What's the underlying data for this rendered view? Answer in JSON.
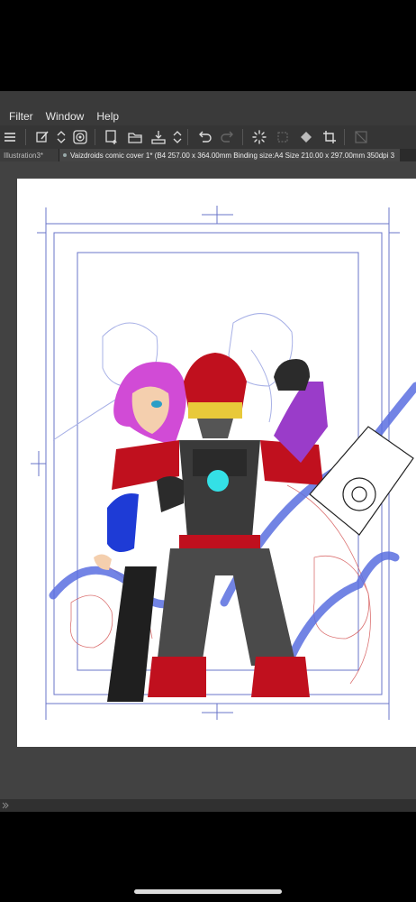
{
  "menubar": {
    "items": [
      "Filter",
      "Window",
      "Help"
    ]
  },
  "toolbar": {
    "icons": [
      "menu-icon",
      "edit-layer-icon",
      "up-down-chevron-icon",
      "spiral-icon",
      "new-canvas-icon",
      "open-folder-icon",
      "save-icon",
      "up-down-chevron-icon",
      "undo-icon",
      "redo-icon",
      "loading-spinner-icon",
      "select-layer-icon",
      "fill-icon",
      "crop-icon",
      "transform-icon"
    ]
  },
  "tabs": {
    "inactive_label": "Illustration3*",
    "active_label": "Vaizdroids comic cover 1* (B4 257.00 x 364.00mm Binding size:A4 Size 210.00 x 297.00mm 350dpi 3"
  },
  "colors": {
    "menubar_bg": "#3a3a3a",
    "toolbar_bg": "#353535",
    "workspace_bg": "#424242",
    "canvas_bg": "#ffffff",
    "guide_blue": "#6a74c8",
    "sketch_red": "#d35050",
    "robot_red": "#c0101e",
    "robot_gray": "#3a3a3a",
    "accent_cyan": "#34e0e6",
    "hair_magenta": "#d14bd6",
    "brush_blue": "#5a6fe0"
  }
}
